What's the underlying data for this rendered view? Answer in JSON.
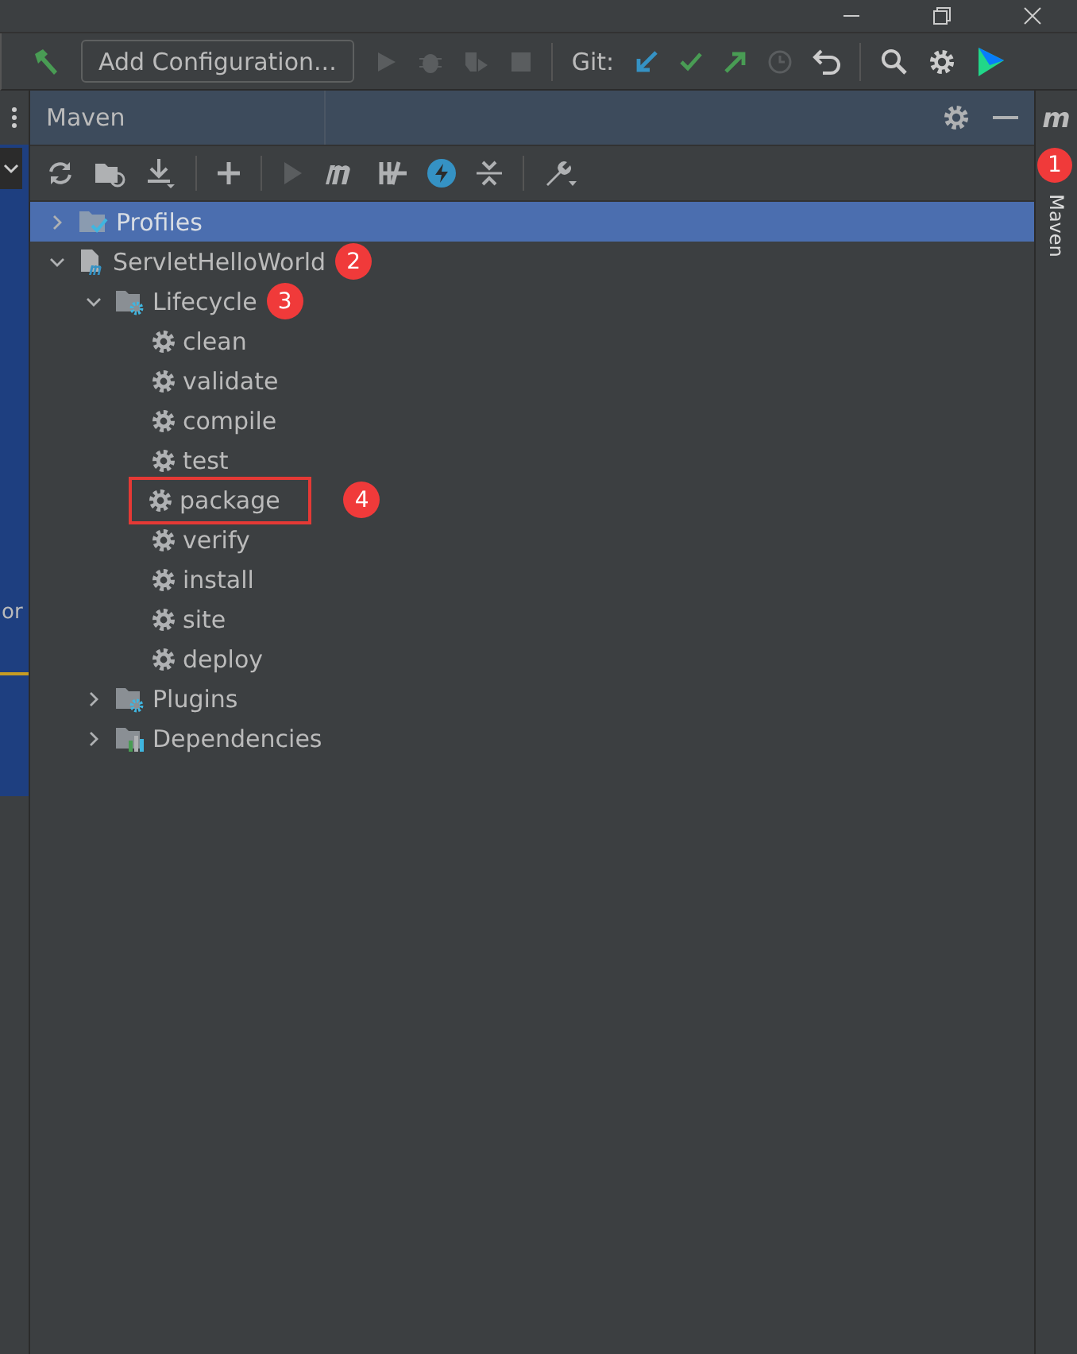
{
  "toolbar": {
    "run_config": "Add Configuration...",
    "git_label": "Git:"
  },
  "left_strip": {
    "fragment": "or"
  },
  "maven_panel": {
    "title": "Maven",
    "tree": [
      {
        "label": "Profiles",
        "kind": "profiles",
        "selected": true,
        "expanded": false
      },
      {
        "label": "ServletHelloWorld",
        "kind": "project",
        "selected": false,
        "expanded": true,
        "badge": "2",
        "children": [
          {
            "label": "Lifecycle",
            "kind": "folder",
            "selected": false,
            "expanded": true,
            "badge": "3",
            "children": [
              {
                "label": "clean",
                "kind": "goal",
                "selected": false
              },
              {
                "label": "validate",
                "kind": "goal",
                "selected": false
              },
              {
                "label": "compile",
                "kind": "goal",
                "selected": false
              },
              {
                "label": "test",
                "kind": "goal",
                "selected": false
              },
              {
                "label": "package",
                "kind": "goal",
                "selected": false,
                "highlighted": true,
                "badge": "4"
              },
              {
                "label": "verify",
                "kind": "goal",
                "selected": false
              },
              {
                "label": "install",
                "kind": "goal",
                "selected": false
              },
              {
                "label": "site",
                "kind": "goal",
                "selected": false
              },
              {
                "label": "deploy",
                "kind": "goal",
                "selected": false
              }
            ]
          },
          {
            "label": "Plugins",
            "kind": "folder",
            "selected": false,
            "expanded": false
          },
          {
            "label": "Dependencies",
            "kind": "deps",
            "selected": false,
            "expanded": false
          }
        ]
      }
    ]
  },
  "side_tab": {
    "icon_letter": "m",
    "label": "Maven",
    "badge": "1"
  }
}
